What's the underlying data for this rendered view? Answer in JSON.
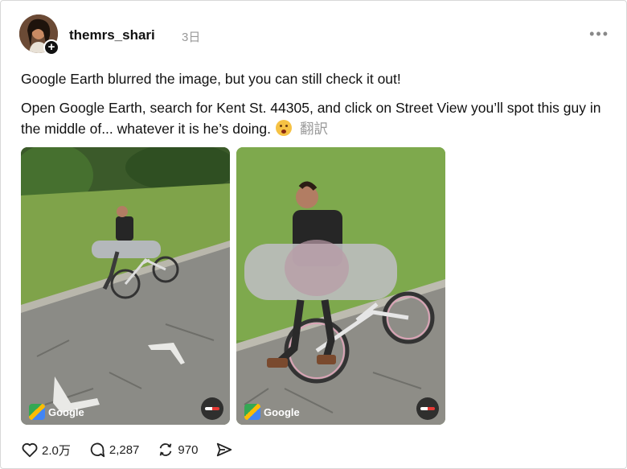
{
  "post": {
    "username": "themrs_shari",
    "timestamp": "3日",
    "more_label": "•••",
    "text_line1": "Google Earth blurred the image, but you can still check it out!",
    "text_line2": "Open Google Earth, search for Kent St. 44305, and click on Street View you’ll spot this guy in the middle of... whatever it is he’s doing.",
    "translate_label": "翻訳"
  },
  "images": [
    {
      "watermark": "Google"
    },
    {
      "watermark": "Google"
    }
  ],
  "actions": {
    "likes": "2.0万",
    "comments": "2,287",
    "reposts": "970"
  },
  "icons": [
    "plus-icon",
    "more-icon",
    "flushed-emoji-icon",
    "google-maps-icon",
    "compass-icon",
    "heart-icon",
    "comment-icon",
    "repost-icon",
    "share-icon"
  ]
}
